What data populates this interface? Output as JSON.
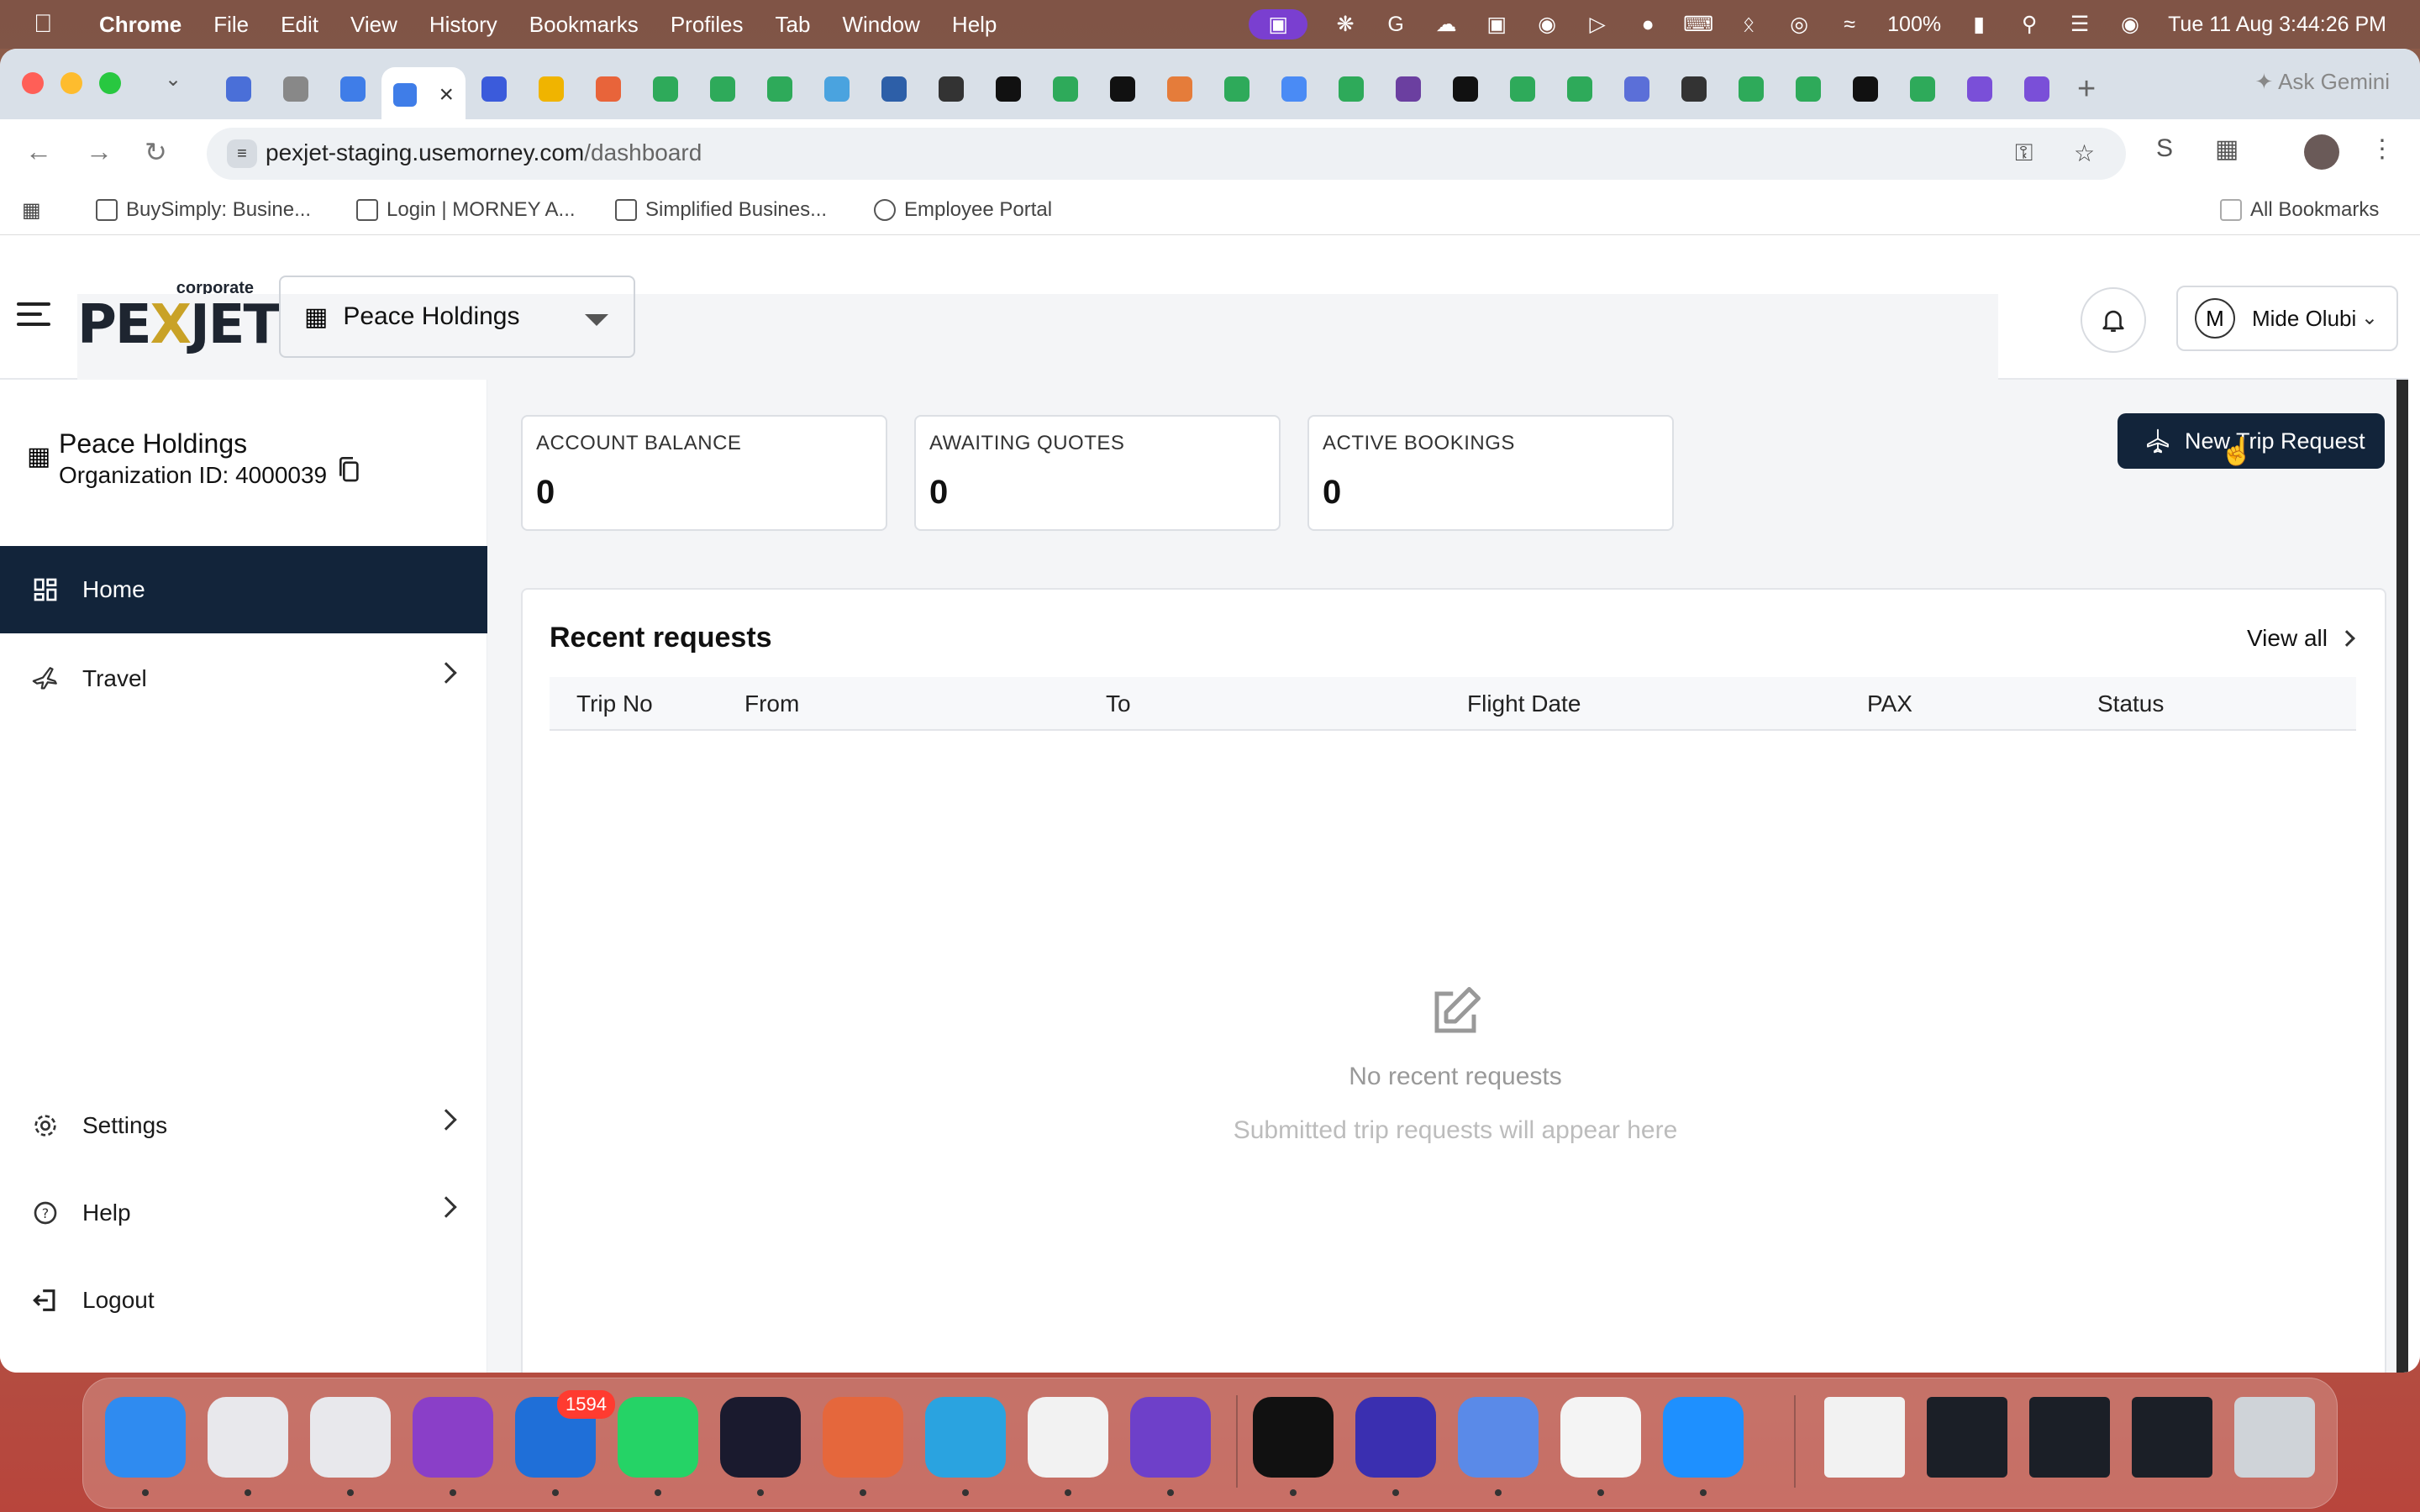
{
  "menubar": {
    "app": "Chrome",
    "items": [
      "File",
      "Edit",
      "View",
      "History",
      "Bookmarks",
      "Profiles",
      "Tab",
      "Window",
      "Help"
    ],
    "battery": "100%",
    "datetime": "Tue 11 Aug  3:44:26 PM"
  },
  "browser": {
    "ask_gemini": "Ask Gemini",
    "url_host": "pexjet-staging.usemorney.com",
    "url_path": "/dashboard",
    "bookmarks": [
      "BuySimply: Busine...",
      "Login | MORNEY A...",
      "Simplified Busines...",
      "Employee Portal"
    ],
    "all_bookmarks": "All Bookmarks",
    "tab_colors": [
      "#4a6fd8",
      "#888",
      "#3f7de8",
      "#3b5bdb",
      "#f0b400",
      "#e8643a",
      "#2eaa5a",
      "#2eaa5a",
      "#2eaa5a",
      "#4aa3df",
      "#2d5fa8",
      "#333",
      "#111",
      "#2eaa5a",
      "#111",
      "#e57c3a",
      "#2eaa5a",
      "#4a8bf5",
      "#2eaa5a",
      "#6b3fa0",
      "#111",
      "#2eaa5a",
      "#2eaa5a",
      "#5b6fd8",
      "#333",
      "#2eaa5a",
      "#2eaa5a",
      "#111",
      "#2eaa5a",
      "#7a4fd8",
      "#7a4fd8"
    ]
  },
  "header": {
    "logo_main_a": "PE",
    "logo_main_x": "X",
    "logo_main_b": "JET",
    "logo_corp": "corporate",
    "org_name": "Peace Holdings",
    "user_initial": "M",
    "user_name": "Mide Olubi"
  },
  "sidebar": {
    "org_name": "Peace Holdings",
    "org_id": "Organization ID: 4000039",
    "items": [
      {
        "label": "Home"
      },
      {
        "label": "Travel"
      },
      {
        "label": "Settings"
      },
      {
        "label": "Help"
      },
      {
        "label": "Logout"
      }
    ]
  },
  "stats": [
    {
      "label": "ACCOUNT BALANCE",
      "value": "0"
    },
    {
      "label": "AWAITING QUOTES",
      "value": "0"
    },
    {
      "label": "ACTIVE BOOKINGS",
      "value": "0"
    }
  ],
  "new_trip_label": "New Trip Request",
  "recent": {
    "title": "Recent requests",
    "view_all": "View all",
    "columns": [
      "Trip No",
      "From",
      "To",
      "Flight Date",
      "PAX",
      "Status"
    ],
    "empty_title": "No recent requests",
    "empty_sub": "Submitted trip requests will appear here"
  },
  "dock": {
    "outlook_badge": "1594",
    "colors": [
      "#2f8bf0",
      "#e8e8ec",
      "#e8e8ec",
      "#8a3fc8",
      "#1f6fd8",
      "#25d366",
      "#1a1a2e",
      "#e5673c",
      "#2aa3e0",
      "#f2f2f2",
      "#6e40c9",
      "#111",
      "#3a2fb0",
      "#5a8ae8",
      "#f4f4f4",
      "#1e90ff"
    ]
  }
}
